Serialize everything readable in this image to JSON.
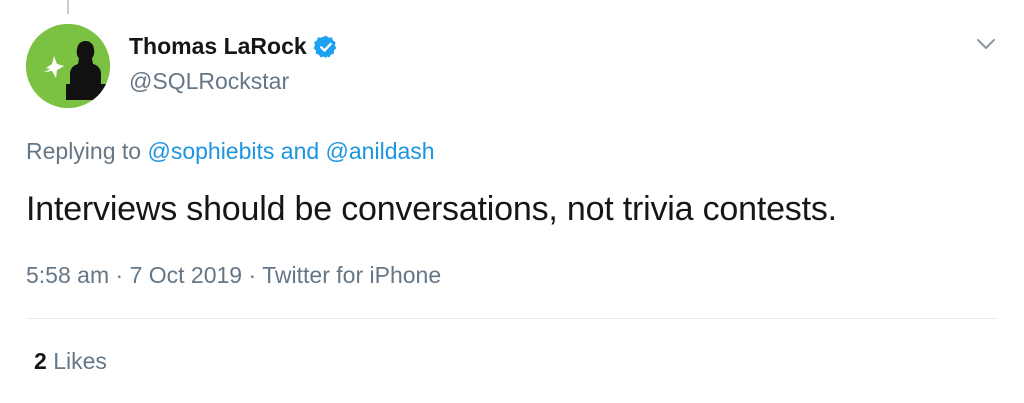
{
  "author": {
    "name": "Thomas LaRock",
    "handle": "@SQLRockstar",
    "verified": true
  },
  "reply_context": {
    "prefix": "Replying to",
    "mention_1": "@sophiebits",
    "joiner": "and",
    "mention_2": "@anildash"
  },
  "tweet": {
    "text": "Interviews should be conversations, not trivia contests.",
    "time": "5:58 am",
    "separator": "·",
    "date": "7 Oct 2019",
    "source": "Twitter for iPhone"
  },
  "stats": {
    "likes_count": "2",
    "likes_label": "Likes"
  },
  "colors": {
    "accent": "#1b95e0",
    "avatar_bg": "#7bc242",
    "muted_text": "#657786",
    "primary_text": "#14171a"
  },
  "icons": {
    "verified": "verified-badge-icon",
    "menu": "chevron-down-icon"
  }
}
